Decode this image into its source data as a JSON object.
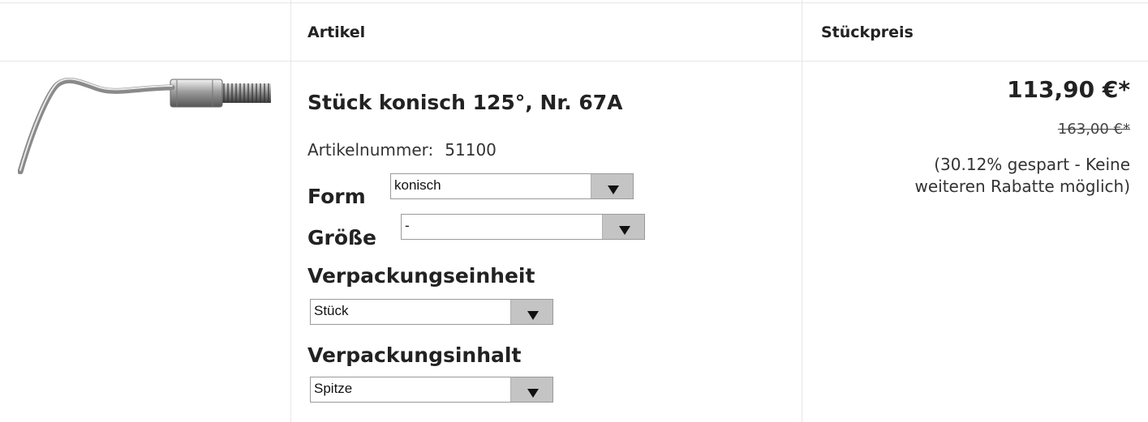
{
  "table": {
    "col_article": "Artikel",
    "col_unit_price": "Stückpreis"
  },
  "product": {
    "image_icon": "scaler-tip-image",
    "title": "Stück konisch 125°, Nr. 67A",
    "article_number_label": "Artikelnummer:",
    "article_number": "51100",
    "options": {
      "form": {
        "label": "Form",
        "value": "konisch"
      },
      "size": {
        "label": "Größe",
        "value": "-"
      },
      "pack_unit": {
        "label": "Verpackungseinheit",
        "value": "Stück"
      },
      "pack_content": {
        "label": "Verpackungsinhalt",
        "value": "Spitze"
      }
    }
  },
  "pricing": {
    "price": "113,90 €*",
    "old_price": "163,00 €*",
    "savings_note": "(30.12% gespart - Keine weiteren Rabatte möglich)"
  }
}
